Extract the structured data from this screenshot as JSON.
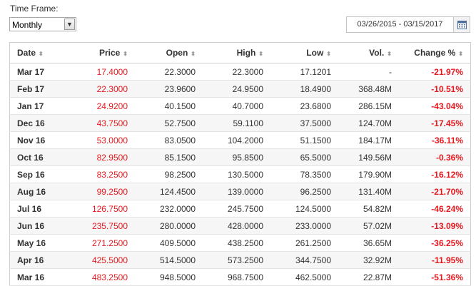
{
  "timeframe": {
    "label": "Time Frame:",
    "selected": "Monthly",
    "date_range": "03/26/2015 - 03/15/2017"
  },
  "table": {
    "columns": [
      "Date",
      "Price",
      "Open",
      "High",
      "Low",
      "Vol.",
      "Change %"
    ],
    "sort_icon": "⬍",
    "rows": [
      {
        "date": "Mar 17",
        "price": "17.4000",
        "open": "22.3000",
        "high": "22.3000",
        "low": "17.1201",
        "vol": "-",
        "change": "-21.97%"
      },
      {
        "date": "Feb 17",
        "price": "22.3000",
        "open": "23.9600",
        "high": "24.9500",
        "low": "18.4900",
        "vol": "368.48M",
        "change": "-10.51%"
      },
      {
        "date": "Jan 17",
        "price": "24.9200",
        "open": "40.1500",
        "high": "40.7000",
        "low": "23.6800",
        "vol": "286.15M",
        "change": "-43.04%"
      },
      {
        "date": "Dec 16",
        "price": "43.7500",
        "open": "52.7500",
        "high": "59.1100",
        "low": "37.5000",
        "vol": "124.70M",
        "change": "-17.45%"
      },
      {
        "date": "Nov 16",
        "price": "53.0000",
        "open": "83.0500",
        "high": "104.2000",
        "low": "51.1500",
        "vol": "184.17M",
        "change": "-36.11%"
      },
      {
        "date": "Oct 16",
        "price": "82.9500",
        "open": "85.1500",
        "high": "95.8500",
        "low": "65.5000",
        "vol": "149.56M",
        "change": "-0.36%"
      },
      {
        "date": "Sep 16",
        "price": "83.2500",
        "open": "98.2500",
        "high": "130.5000",
        "low": "78.3500",
        "vol": "179.90M",
        "change": "-16.12%"
      },
      {
        "date": "Aug 16",
        "price": "99.2500",
        "open": "124.4500",
        "high": "139.0000",
        "low": "96.2500",
        "vol": "131.40M",
        "change": "-21.70%"
      },
      {
        "date": "Jul 16",
        "price": "126.7500",
        "open": "232.0000",
        "high": "245.7500",
        "low": "124.5000",
        "vol": "54.82M",
        "change": "-46.24%"
      },
      {
        "date": "Jun 16",
        "price": "235.7500",
        "open": "280.0000",
        "high": "428.0000",
        "low": "233.0000",
        "vol": "57.02M",
        "change": "-13.09%"
      },
      {
        "date": "May 16",
        "price": "271.2500",
        "open": "409.5000",
        "high": "438.2500",
        "low": "261.2500",
        "vol": "36.65M",
        "change": "-36.25%"
      },
      {
        "date": "Apr 16",
        "price": "425.5000",
        "open": "514.5000",
        "high": "573.2500",
        "low": "344.7500",
        "vol": "32.92M",
        "change": "-11.95%"
      },
      {
        "date": "Mar 16",
        "price": "483.2500",
        "open": "948.5000",
        "high": "968.7500",
        "low": "462.5000",
        "vol": "22.87M",
        "change": "-51.36%"
      }
    ]
  },
  "colors": {
    "negative": "#e8191e",
    "row_alt": "#f6f6f6",
    "border": "#cfcfcf"
  }
}
